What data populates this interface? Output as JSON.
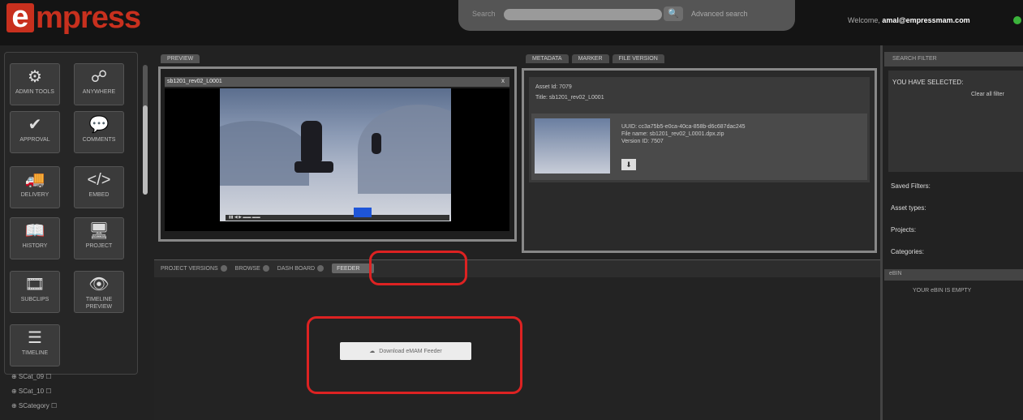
{
  "header": {
    "logo_first": "e",
    "logo_rest": "mpress",
    "search_label": "Search",
    "search_placeholder": "",
    "advanced_search": "Advanced search",
    "welcome": "Welcome, ",
    "user": "amal@empressmam.com"
  },
  "tools": [
    {
      "label": "ADMIN TOOLS",
      "icon": "gear-icon",
      "glyph": "⚙"
    },
    {
      "label": "ANYWHERE",
      "icon": "share-icon",
      "glyph": "☍"
    },
    {
      "label": "APPROVAL",
      "icon": "checkmark-icon",
      "glyph": "✔"
    },
    {
      "label": "COMMENTS",
      "icon": "speech-bubble-icon",
      "glyph": "💬"
    },
    {
      "label": "DELIVERY",
      "icon": "truck-icon",
      "glyph": "🚚"
    },
    {
      "label": "EMBED",
      "icon": "code-icon",
      "glyph": "</>"
    },
    {
      "label": "HISTORY",
      "icon": "book-icon",
      "glyph": "📖"
    },
    {
      "label": "PROJECT",
      "icon": "monitor-icon",
      "glyph": "🖥"
    },
    {
      "label": "SUBCLIPS",
      "icon": "film-icon",
      "glyph": "🎞"
    },
    {
      "label": "TIMELINE PREVIEW",
      "icon": "eye-icon",
      "glyph": "👁"
    },
    {
      "label": "TIMELINE",
      "icon": "list-icon",
      "glyph": "☰"
    }
  ],
  "categories": [
    "SCat_09",
    "SCat_10",
    "SCategory"
  ],
  "preview": {
    "tab": "PREVIEW",
    "title": "sb1201_rev02_L0001",
    "close": "x"
  },
  "metadata": {
    "tabs": [
      "METADATA",
      "MARKER",
      "FILE VERSION"
    ],
    "asset_id": "Asset Id: 7079",
    "title": "Title: sb1201_rev02_L0001",
    "uuid": "UUID: cc3a75b5-e0ca-40ca-858b-d6c687dac245",
    "file_name": "File name: sb1201_rev02_L0001.dpx.zip",
    "version_id": "Version ID: 7507"
  },
  "bottom_tabs": [
    {
      "label": "PROJECT VERSIONS",
      "active": false
    },
    {
      "label": "BROWSE",
      "active": false
    },
    {
      "label": "DASH BOARD",
      "active": false
    },
    {
      "label": "FEEDER",
      "active": true
    }
  ],
  "download_button": "Download eMAM Feeder",
  "search_filter": {
    "heading": "SEARCH FILTER",
    "you_selected": "YOU HAVE SELECTED:",
    "clear": "Clear all filter",
    "saved_filters": "Saved Filters:",
    "asset_types": "Asset types:",
    "projects": "Projects:",
    "categories": "Categories:"
  },
  "ebin": {
    "heading": "eBIN",
    "empty": "YOUR eBIN IS EMPTY"
  },
  "colors": {
    "brand": "#c8301e",
    "highlight": "#dd2222",
    "online": "#3bb33b"
  }
}
